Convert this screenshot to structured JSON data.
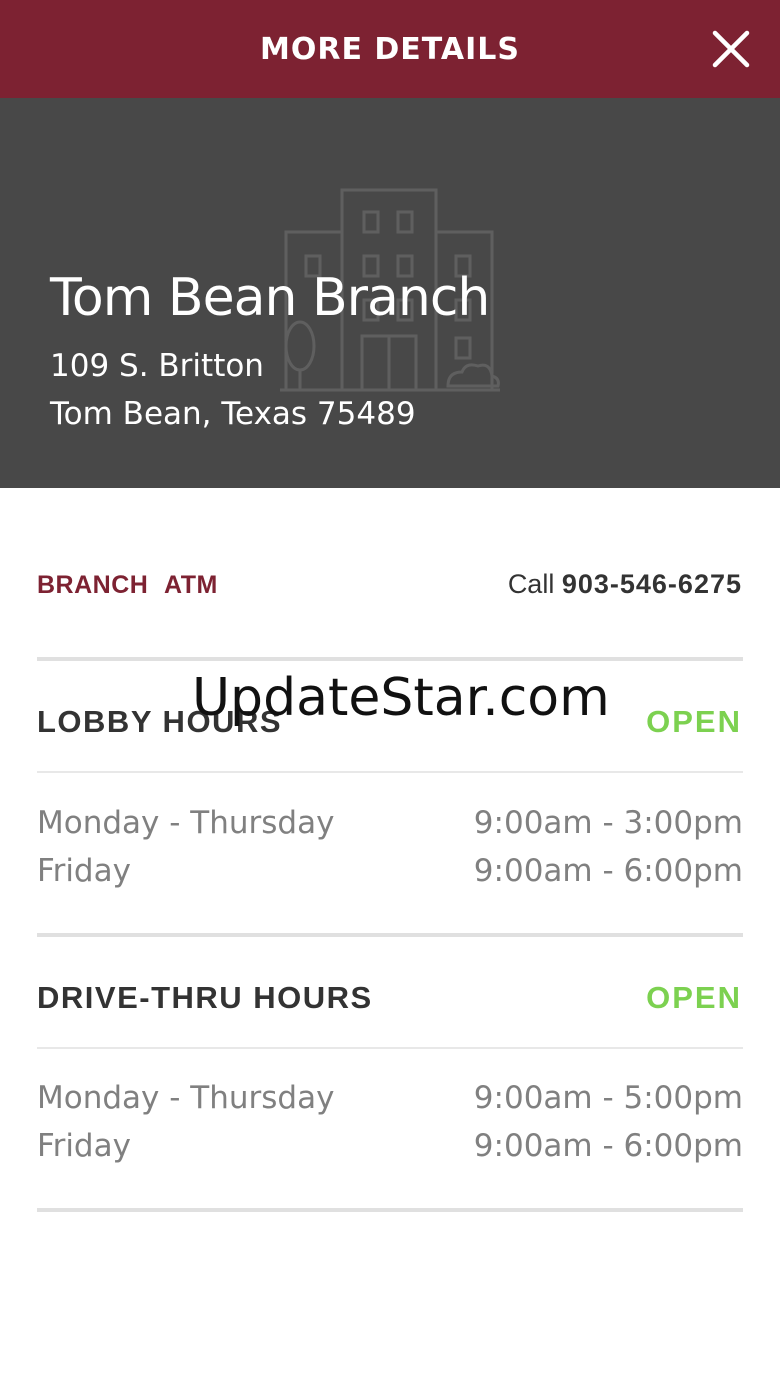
{
  "header": {
    "title": "MORE DETAILS"
  },
  "branch": {
    "name": "Tom Bean Branch",
    "address_line1": "109 S. Britton",
    "address_line2": "Tom Bean, Texas 75489"
  },
  "tabs": [
    {
      "label": "BRANCH"
    },
    {
      "label": "ATM"
    }
  ],
  "contact": {
    "call_label": "Call",
    "phone": "903-546-6275"
  },
  "lobby": {
    "title": "LOBBY HOURS",
    "status": "OPEN",
    "rows": [
      {
        "day": "Monday - Thursday",
        "time": "9:00am - 3:00pm"
      },
      {
        "day": "Friday",
        "time": "9:00am - 6:00pm"
      }
    ]
  },
  "drive_thru": {
    "title": "DRIVE-THRU HOURS",
    "status": "OPEN",
    "rows": [
      {
        "day": "Monday - Thursday",
        "time": "9:00am - 5:00pm"
      },
      {
        "day": "Friday",
        "time": "9:00am - 6:00pm"
      }
    ]
  },
  "watermark": "UpdateStar.com",
  "colors": {
    "header_bg": "#7d2232",
    "hero_bg": "#484848",
    "accent": "#7d2232",
    "open_status": "#7cd150"
  },
  "icons": {
    "close": "close-icon",
    "building": "building-icon"
  }
}
